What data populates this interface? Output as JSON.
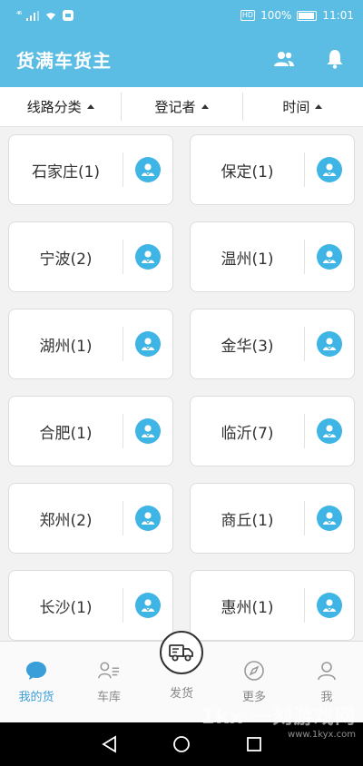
{
  "status": {
    "signal": "⁴⁶",
    "battery_percent": "100%",
    "hd": "HD",
    "time": "11:01"
  },
  "appbar": {
    "title": "货满车货主"
  },
  "filters": [
    {
      "label": "线路分类"
    },
    {
      "label": "登记者"
    },
    {
      "label": "时间"
    }
  ],
  "cards": [
    {
      "label": "石家庄(1)"
    },
    {
      "label": "保定(1)"
    },
    {
      "label": "宁波(2)"
    },
    {
      "label": "温州(1)"
    },
    {
      "label": "湖州(1)"
    },
    {
      "label": "金华(3)"
    },
    {
      "label": "合肥(1)"
    },
    {
      "label": "临沂(7)"
    },
    {
      "label": "郑州(2)"
    },
    {
      "label": "商丘(1)"
    },
    {
      "label": "长沙(1)"
    },
    {
      "label": "惠州(1)"
    }
  ],
  "tabs": [
    {
      "label": "我的货"
    },
    {
      "label": "车库"
    },
    {
      "label": "发货"
    },
    {
      "label": "更多"
    },
    {
      "label": "我"
    }
  ],
  "watermark": {
    "main": "1kx 一刻游戏网",
    "url": "www.1kyx.com"
  },
  "colors": {
    "primary": "#5bbde3",
    "accent": "#3eb5e5",
    "tab_active": "#3a9fd8"
  }
}
